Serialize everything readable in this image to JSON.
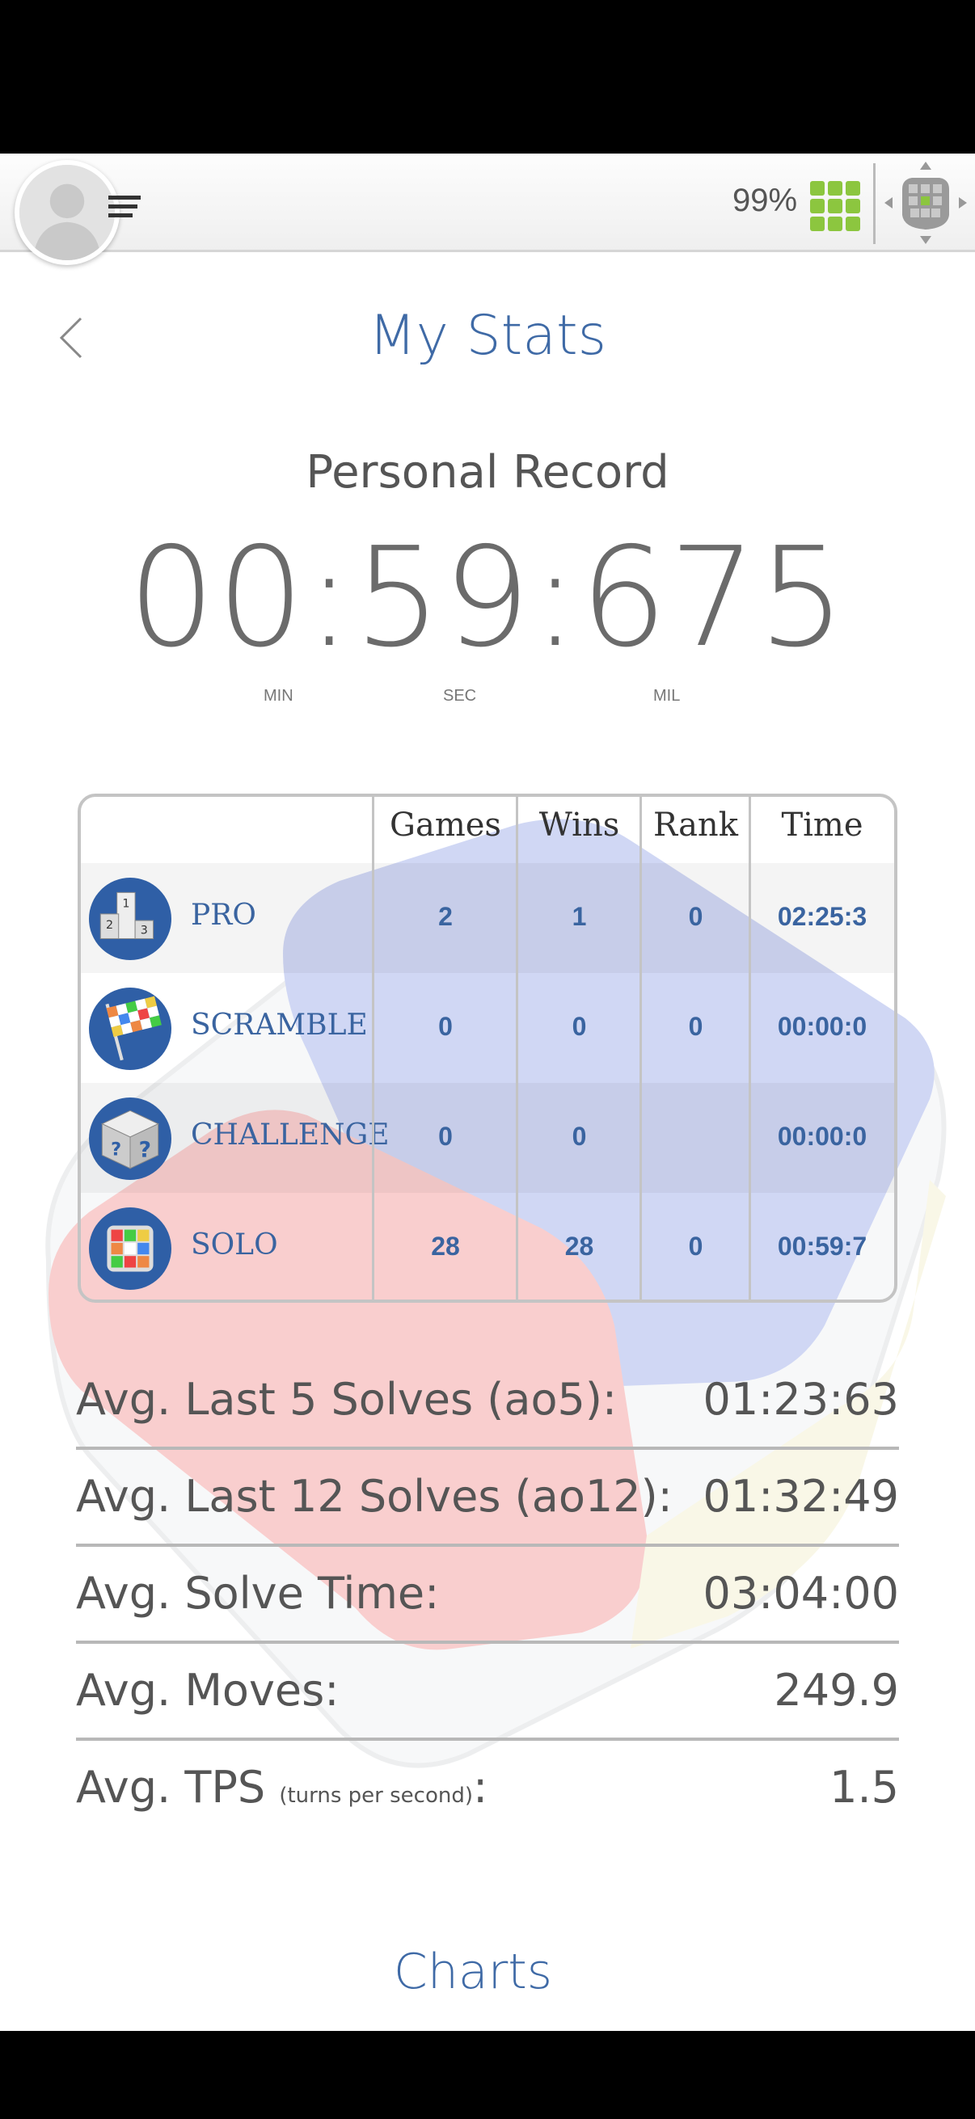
{
  "topbar": {
    "battery": "99%",
    "avatar_icon": "user-avatar-icon",
    "menu_icon": "menu-icon",
    "grid_icon": "grid-icon",
    "cube_nav_icon": "cube-dpad-icon",
    "accent_color": "#3f6aa6",
    "grid_color": "#8cc63f"
  },
  "header": {
    "title": "My Stats"
  },
  "personal_record": {
    "label": "Personal Record",
    "time": "00:59:675",
    "units": [
      "MIN",
      "SEC",
      "MIL"
    ]
  },
  "table": {
    "columns": [
      "Games",
      "Wins",
      "Rank",
      "Time"
    ],
    "rows": [
      {
        "icon": "podium-cube-icon",
        "mode": "PRO",
        "games": "2",
        "wins": "1",
        "rank": "0",
        "time": "02:25:3"
      },
      {
        "icon": "checkered-flag-icon",
        "mode": "SCRAMBLE",
        "games": "0",
        "wins": "0",
        "rank": "0",
        "time": "00:00:0"
      },
      {
        "icon": "question-cube-icon",
        "mode": "CHALLENGE",
        "games": "0",
        "wins": "0",
        "rank": "",
        "time": "00:00:0"
      },
      {
        "icon": "colored-cube-icon",
        "mode": "SOLO",
        "games": "28",
        "wins": "28",
        "rank": "0",
        "time": "00:59:7"
      }
    ]
  },
  "averages": [
    {
      "label": "Avg. Last 5 Solves (ao5):",
      "value": "01:23:63"
    },
    {
      "label": "Avg. Last 12 Solves (ao12):",
      "value": "01:32:49"
    },
    {
      "label": "Avg. Solve Time:",
      "value": "03:04:00"
    },
    {
      "label": "Avg. Moves:",
      "value": "249.9"
    },
    {
      "label": "Avg. TPS",
      "sub": "(turns per second)",
      "suffix": ":",
      "value": "1.5"
    }
  ],
  "charts_link": "Charts"
}
